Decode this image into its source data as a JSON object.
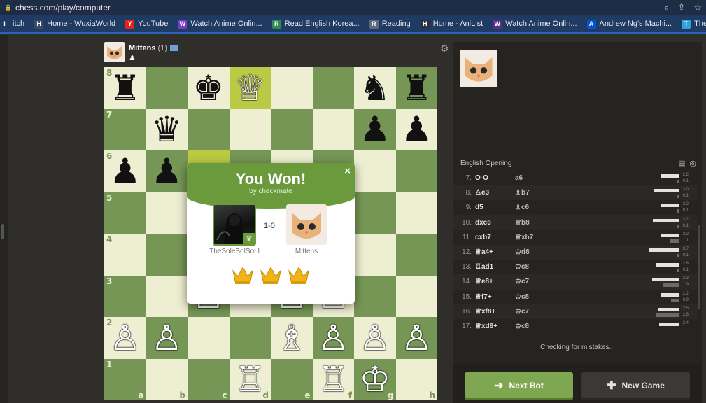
{
  "browser": {
    "url": "chess.com/play/computer",
    "bookmarks": [
      {
        "label": "itch",
        "icon": "twitch-icon",
        "color": "#1f3a63"
      },
      {
        "label": "Home - WuxiaWorld",
        "icon": "wuxiaworld-icon",
        "color": "#3a4a66"
      },
      {
        "label": "YouTube",
        "icon": "youtube-icon",
        "color": "#e62117"
      },
      {
        "label": "Watch Anime Onlin...",
        "icon": "play-icon",
        "color": "#7a3cc2"
      },
      {
        "label": "Read English Korea...",
        "icon": "book-icon",
        "color": "#2f8a4f"
      },
      {
        "label": "Reading",
        "icon": "globe-icon",
        "color": "#5b6a80"
      },
      {
        "label": "Home · AniList",
        "icon": "anilist-icon",
        "color": "#2b2d42"
      },
      {
        "label": "Watch Anime Onlin...",
        "icon": "anime-icon",
        "color": "#5a2f8a"
      },
      {
        "label": "Andrew Ng's Machi...",
        "icon": "coursera-icon",
        "color": "#0056d2"
      },
      {
        "label": "The Ultimate Guide...",
        "icon": "guide-icon",
        "color": "#33a1e0"
      }
    ]
  },
  "top_player": {
    "name": "Mittens",
    "rating": "(1)"
  },
  "board": {
    "ranks": [
      "8",
      "7",
      "6",
      "5",
      "4",
      "3",
      "2",
      "1"
    ],
    "files": [
      "a",
      "b",
      "c",
      "d",
      "e",
      "f",
      "g",
      "h"
    ],
    "squares": [
      [
        "♜",
        "",
        "♚",
        "♕",
        "",
        "",
        "♞",
        "♜"
      ],
      [
        "",
        "♛",
        "",
        "",
        "",
        "",
        "♟",
        "♟"
      ],
      [
        "♟",
        "♟",
        "",
        "",
        "",
        "",
        "",
        ""
      ],
      [
        "",
        "",
        "",
        "",
        "",
        "",
        "",
        ""
      ],
      [
        "",
        "",
        "",
        "",
        "",
        "",
        "",
        ""
      ],
      [
        "",
        "",
        "♙",
        "",
        "♙",
        "♙",
        "",
        ""
      ],
      [
        "♙",
        "♙",
        "",
        "",
        "♗",
        "♙",
        "♙",
        "♙"
      ],
      [
        "",
        "",
        "",
        "♖",
        "",
        "♖",
        "♔",
        ""
      ]
    ],
    "highlights": [
      "d8",
      "c6"
    ]
  },
  "modal": {
    "title": "You Won!",
    "subtitle": "by checkmate",
    "score": "1-0",
    "winner_name": "TheSoleSolSoul",
    "loser_name": "Mittens",
    "close": "×"
  },
  "panel": {
    "opening": "English Opening",
    "moves": [
      {
        "n": "7.",
        "w": "O-O",
        "b": "a6",
        "e1": "2.2",
        "e2": "0.1",
        "b1": 0.42,
        "b2": 0.05
      },
      {
        "n": "8.",
        "w": "♙e3",
        "b": "♗b7",
        "e1": "3.0",
        "e2": "0.1",
        "b1": 0.58,
        "b2": 0.05
      },
      {
        "n": "9.",
        "w": "d5",
        "b": "♗c6",
        "e1": "2.2",
        "e2": "0.1",
        "b1": 0.42,
        "b2": 0.05
      },
      {
        "n": "10.",
        "w": "dxc6",
        "b": "♕b8",
        "e1": "3.2",
        "e2": "0.1",
        "b1": 0.62,
        "b2": 0.05
      },
      {
        "n": "11.",
        "w": "cxb7",
        "b": "♕xb7",
        "e1": "2.2",
        "e2": "1.1",
        "b1": 0.42,
        "b2": 0.22
      },
      {
        "n": "12.",
        "w": "♕a4+",
        "b": "♔d8",
        "e1": "3.7",
        "e2": "0.1",
        "b1": 0.72,
        "b2": 0.05
      },
      {
        "n": "13.",
        "w": "♖ad1",
        "b": "♔c8",
        "e1": "2.8",
        "e2": "0.1",
        "b1": 0.54,
        "b2": 0.05
      },
      {
        "n": "14.",
        "w": "♕e8+",
        "b": "♔c7",
        "e1": "3.3",
        "e2": "1.9",
        "b1": 0.64,
        "b2": 0.38
      },
      {
        "n": "15.",
        "w": "♕f7+",
        "b": "♔c8",
        "e1": "2.2",
        "e2": "0.9",
        "b1": 0.42,
        "b2": 0.18
      },
      {
        "n": "16.",
        "w": "♕xf8+",
        "b": "♔c7",
        "e1": "2.5",
        "e2": "2.8",
        "b1": 0.48,
        "b2": 0.55
      },
      {
        "n": "17.",
        "w": "♕xd6+",
        "b": "♔c8",
        "e1": "2.4",
        "e2": "",
        "b1": 0.46,
        "b2": 0
      }
    ],
    "checking": "Checking for mistakes...",
    "next_bot": "Next Bot",
    "new_game": "New Game"
  }
}
